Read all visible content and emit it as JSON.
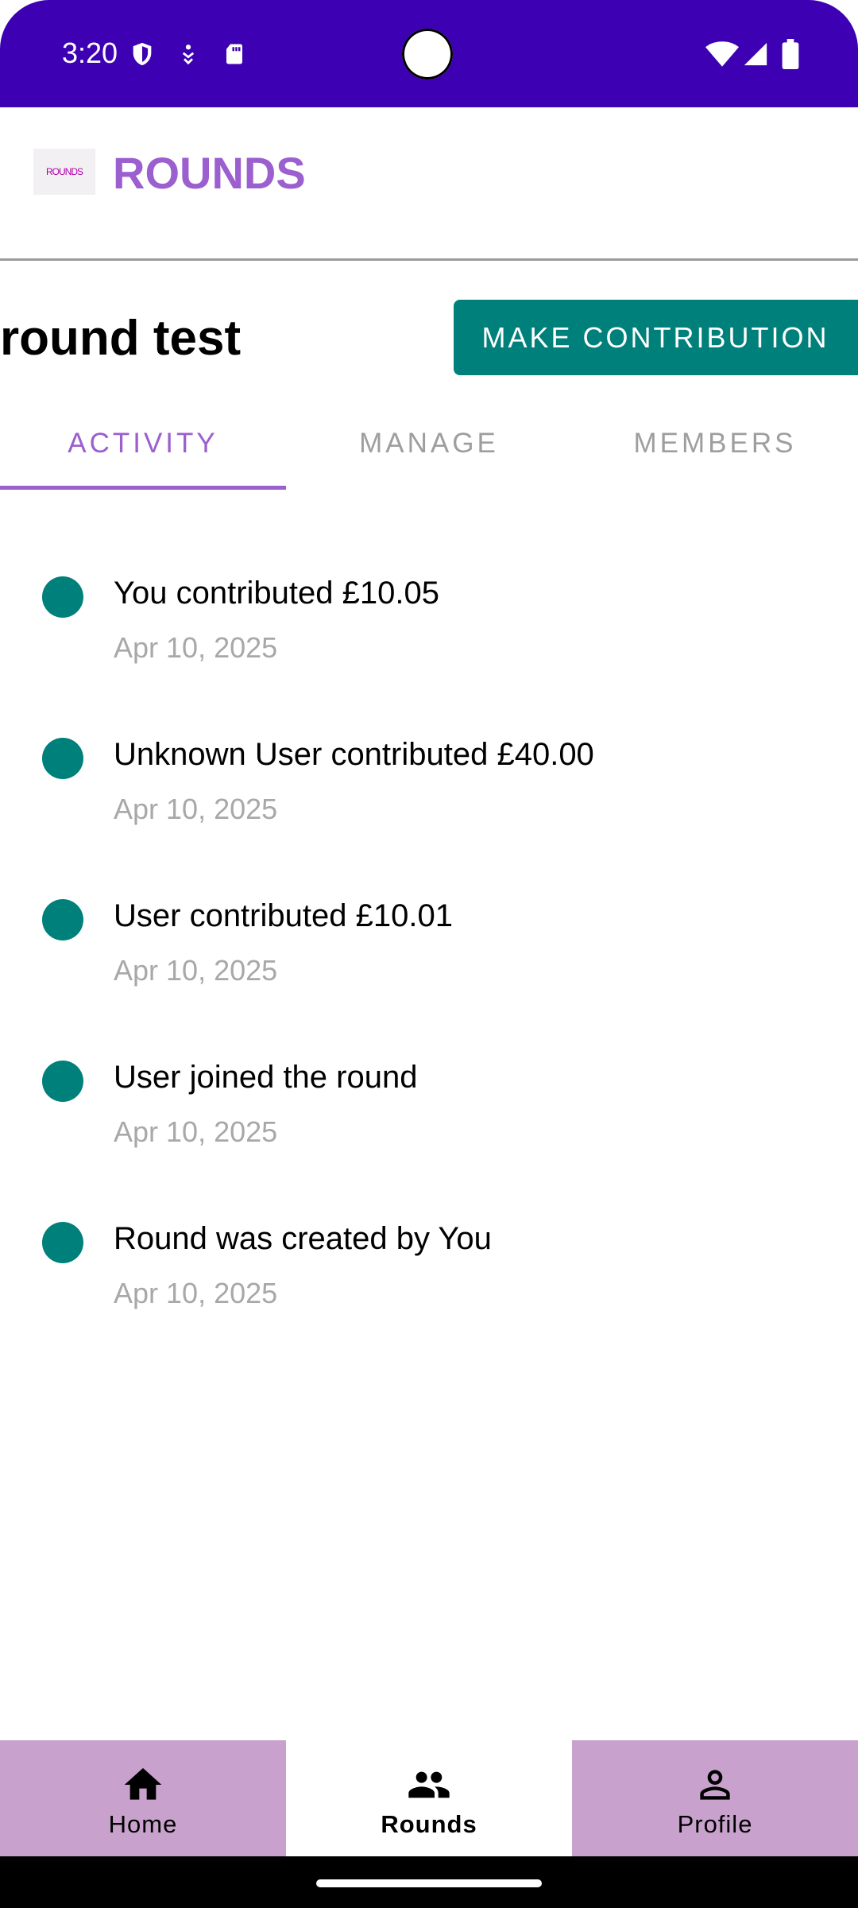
{
  "status_bar": {
    "time": "3:20",
    "icons": [
      "shield-icon",
      "accessibility-icon",
      "sd-card-icon",
      "wifi-icon",
      "signal-icon",
      "battery-icon"
    ]
  },
  "app_bar": {
    "logo_text": "ROUNDS",
    "title": "ROUNDS"
  },
  "round": {
    "title": "round test",
    "make_contribution_label": "MAKE CONTRIBUTION"
  },
  "tabs": [
    {
      "label": "ACTIVITY",
      "active": true
    },
    {
      "label": "MANAGE",
      "active": false
    },
    {
      "label": "MEMBERS",
      "active": false
    }
  ],
  "activity": [
    {
      "text": "You contributed £10.05",
      "date": "Apr 10, 2025"
    },
    {
      "text": "Unknown User contributed £40.00",
      "date": "Apr 10, 2025"
    },
    {
      "text": "User contributed £10.01",
      "date": "Apr 10, 2025"
    },
    {
      "text": "User joined the round",
      "date": "Apr 10, 2025"
    },
    {
      "text": "Round was created by You",
      "date": "Apr 10, 2025"
    }
  ],
  "bottom_nav": [
    {
      "label": "Home",
      "icon": "home-icon",
      "active": false
    },
    {
      "label": "Rounds",
      "icon": "group-icon",
      "active": true
    },
    {
      "label": "Profile",
      "icon": "person-icon",
      "active": false
    }
  ],
  "colors": {
    "status_bar": "#3d00b3",
    "accent_purple": "#9b5fcf",
    "teal": "#00807a",
    "nav_background": "#c8a2cc"
  }
}
